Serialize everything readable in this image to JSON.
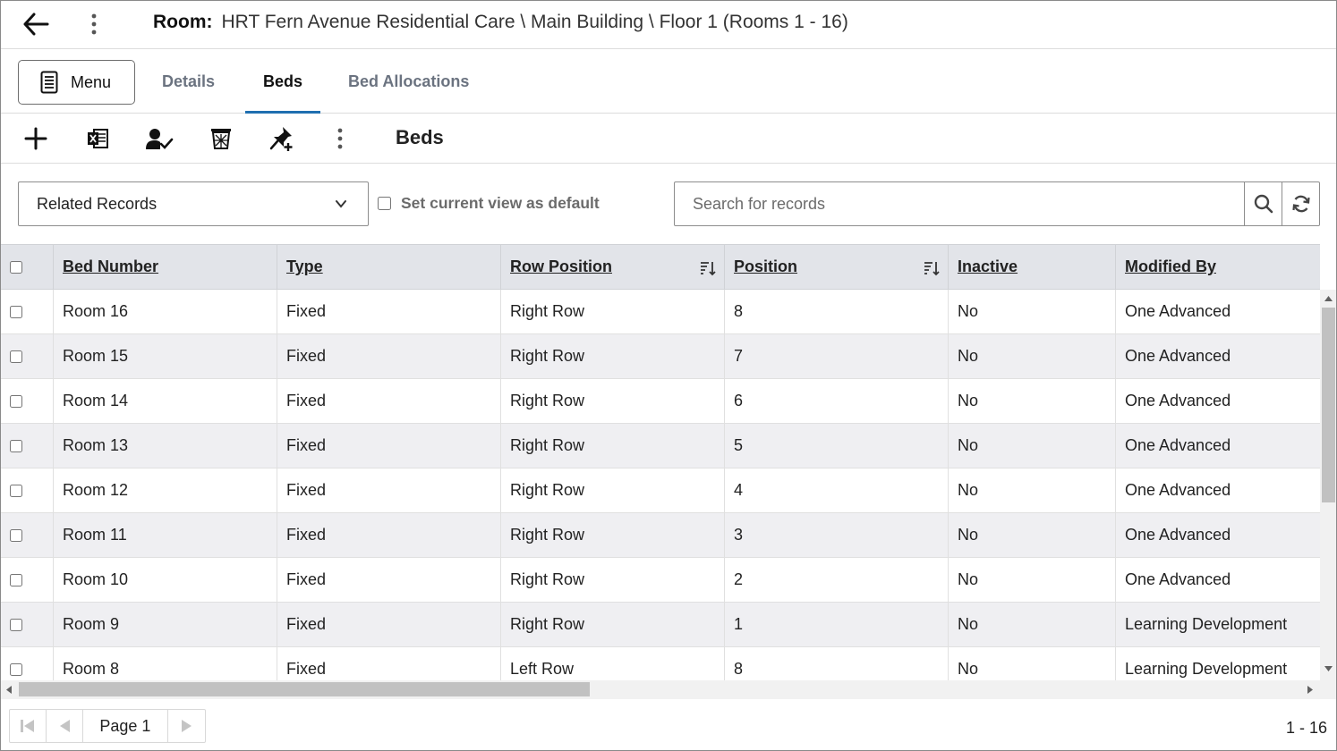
{
  "header": {
    "title_label": "Room:",
    "title_path": "HRT Fern Avenue Residential Care \\ Main Building \\ Floor 1 (Rooms 1 - 16)"
  },
  "tabs": {
    "menu_label": "Menu",
    "items": [
      {
        "label": "Details",
        "active": false
      },
      {
        "label": "Beds",
        "active": true
      },
      {
        "label": "Bed Allocations",
        "active": false
      }
    ]
  },
  "toolbar": {
    "title": "Beds",
    "icons": [
      "plus-icon",
      "excel-export-icon",
      "assign-user-icon",
      "delete-bin-icon",
      "pin-add-icon",
      "more-vertical-icon"
    ]
  },
  "filters": {
    "view_selected": "Related Records",
    "default_label": "Set current view as default",
    "search_placeholder": "Search for records"
  },
  "table": {
    "columns": [
      "Bed Number",
      "Type",
      "Row Position",
      "Position",
      "Inactive",
      "Modified By"
    ],
    "rows": [
      [
        "Room 16",
        "Fixed",
        "Right Row",
        "8",
        "No",
        "One Advanced"
      ],
      [
        "Room 15",
        "Fixed",
        "Right Row",
        "7",
        "No",
        "One Advanced"
      ],
      [
        "Room 14",
        "Fixed",
        "Right Row",
        "6",
        "No",
        "One Advanced"
      ],
      [
        "Room 13",
        "Fixed",
        "Right Row",
        "5",
        "No",
        "One Advanced"
      ],
      [
        "Room 12",
        "Fixed",
        "Right Row",
        "4",
        "No",
        "One Advanced"
      ],
      [
        "Room 11",
        "Fixed",
        "Right Row",
        "3",
        "No",
        "One Advanced"
      ],
      [
        "Room 10",
        "Fixed",
        "Right Row",
        "2",
        "No",
        "One Advanced"
      ],
      [
        "Room 9",
        "Fixed",
        "Right Row",
        "1",
        "No",
        "Learning Development"
      ],
      [
        "Room 8",
        "Fixed",
        "Left Row",
        "8",
        "No",
        "Learning Development"
      ]
    ]
  },
  "pager": {
    "page_label": "Page 1",
    "record_range": "1 - 16"
  },
  "colors": {
    "accent": "#1f6fb0",
    "header_bg": "#e2e4e9",
    "alt_row_bg": "#efeff2"
  }
}
